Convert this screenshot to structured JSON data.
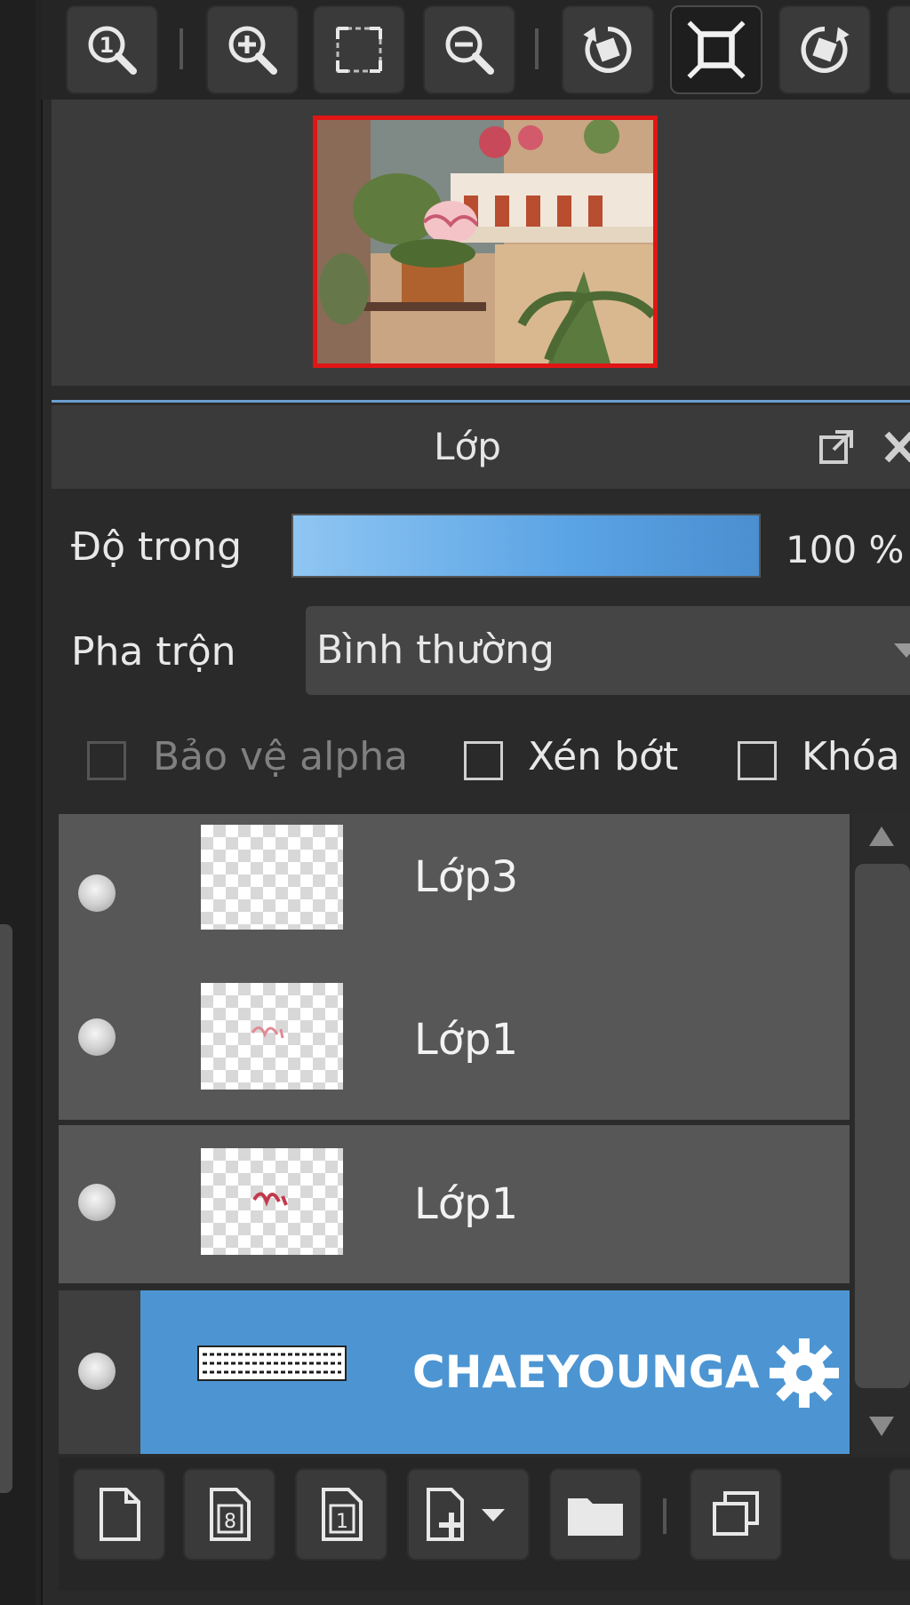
{
  "toolbar": {
    "buttons": [
      {
        "icon": "zoom-actual-size-icon"
      },
      {
        "icon": "zoom-in-icon"
      },
      {
        "icon": "fit-to-screen-icon"
      },
      {
        "icon": "zoom-out-icon"
      },
      {
        "icon": "rotate-left-icon"
      },
      {
        "icon": "fullscreen-icon",
        "active": true
      },
      {
        "icon": "rotate-right-icon"
      }
    ]
  },
  "navigator": {
    "thumbnail": "canvas-preview"
  },
  "layer_panel": {
    "title": "Lớp",
    "opacity": {
      "label": "Độ trong",
      "value": "100 %",
      "level": 1.0
    },
    "blend": {
      "label": "Pha trộn",
      "value": "Bình thường"
    },
    "checkboxes": {
      "protect_alpha": {
        "label": "Bảo vệ alpha",
        "checked": false,
        "enabled": false
      },
      "clipping": {
        "label": "Xén bớt",
        "checked": false,
        "enabled": true
      },
      "lock": {
        "label": "Khóa",
        "checked": false,
        "enabled": true
      }
    },
    "layers": [
      {
        "name": "Lớp3",
        "selected": false
      },
      {
        "name": "Lớp1",
        "selected": false
      },
      {
        "name": "Lớp1",
        "selected": false
      },
      {
        "name": "CHAEYOUNGA",
        "selected": true
      }
    ]
  },
  "bottom_toolbar": {
    "buttons": [
      {
        "icon": "new-layer-icon"
      },
      {
        "icon": "new-layer-8bit-icon",
        "glyph": "8"
      },
      {
        "icon": "new-layer-1bit-icon",
        "glyph": "1"
      },
      {
        "icon": "add-layer-dropdown-icon"
      },
      {
        "icon": "folder-icon"
      },
      {
        "icon": "duplicate-layer-icon"
      }
    ]
  },
  "colors": {
    "accent": "#4d95d2",
    "panel_bg": "#2a2a2a",
    "row_bg": "#575757",
    "nav_border": "#e01515"
  }
}
